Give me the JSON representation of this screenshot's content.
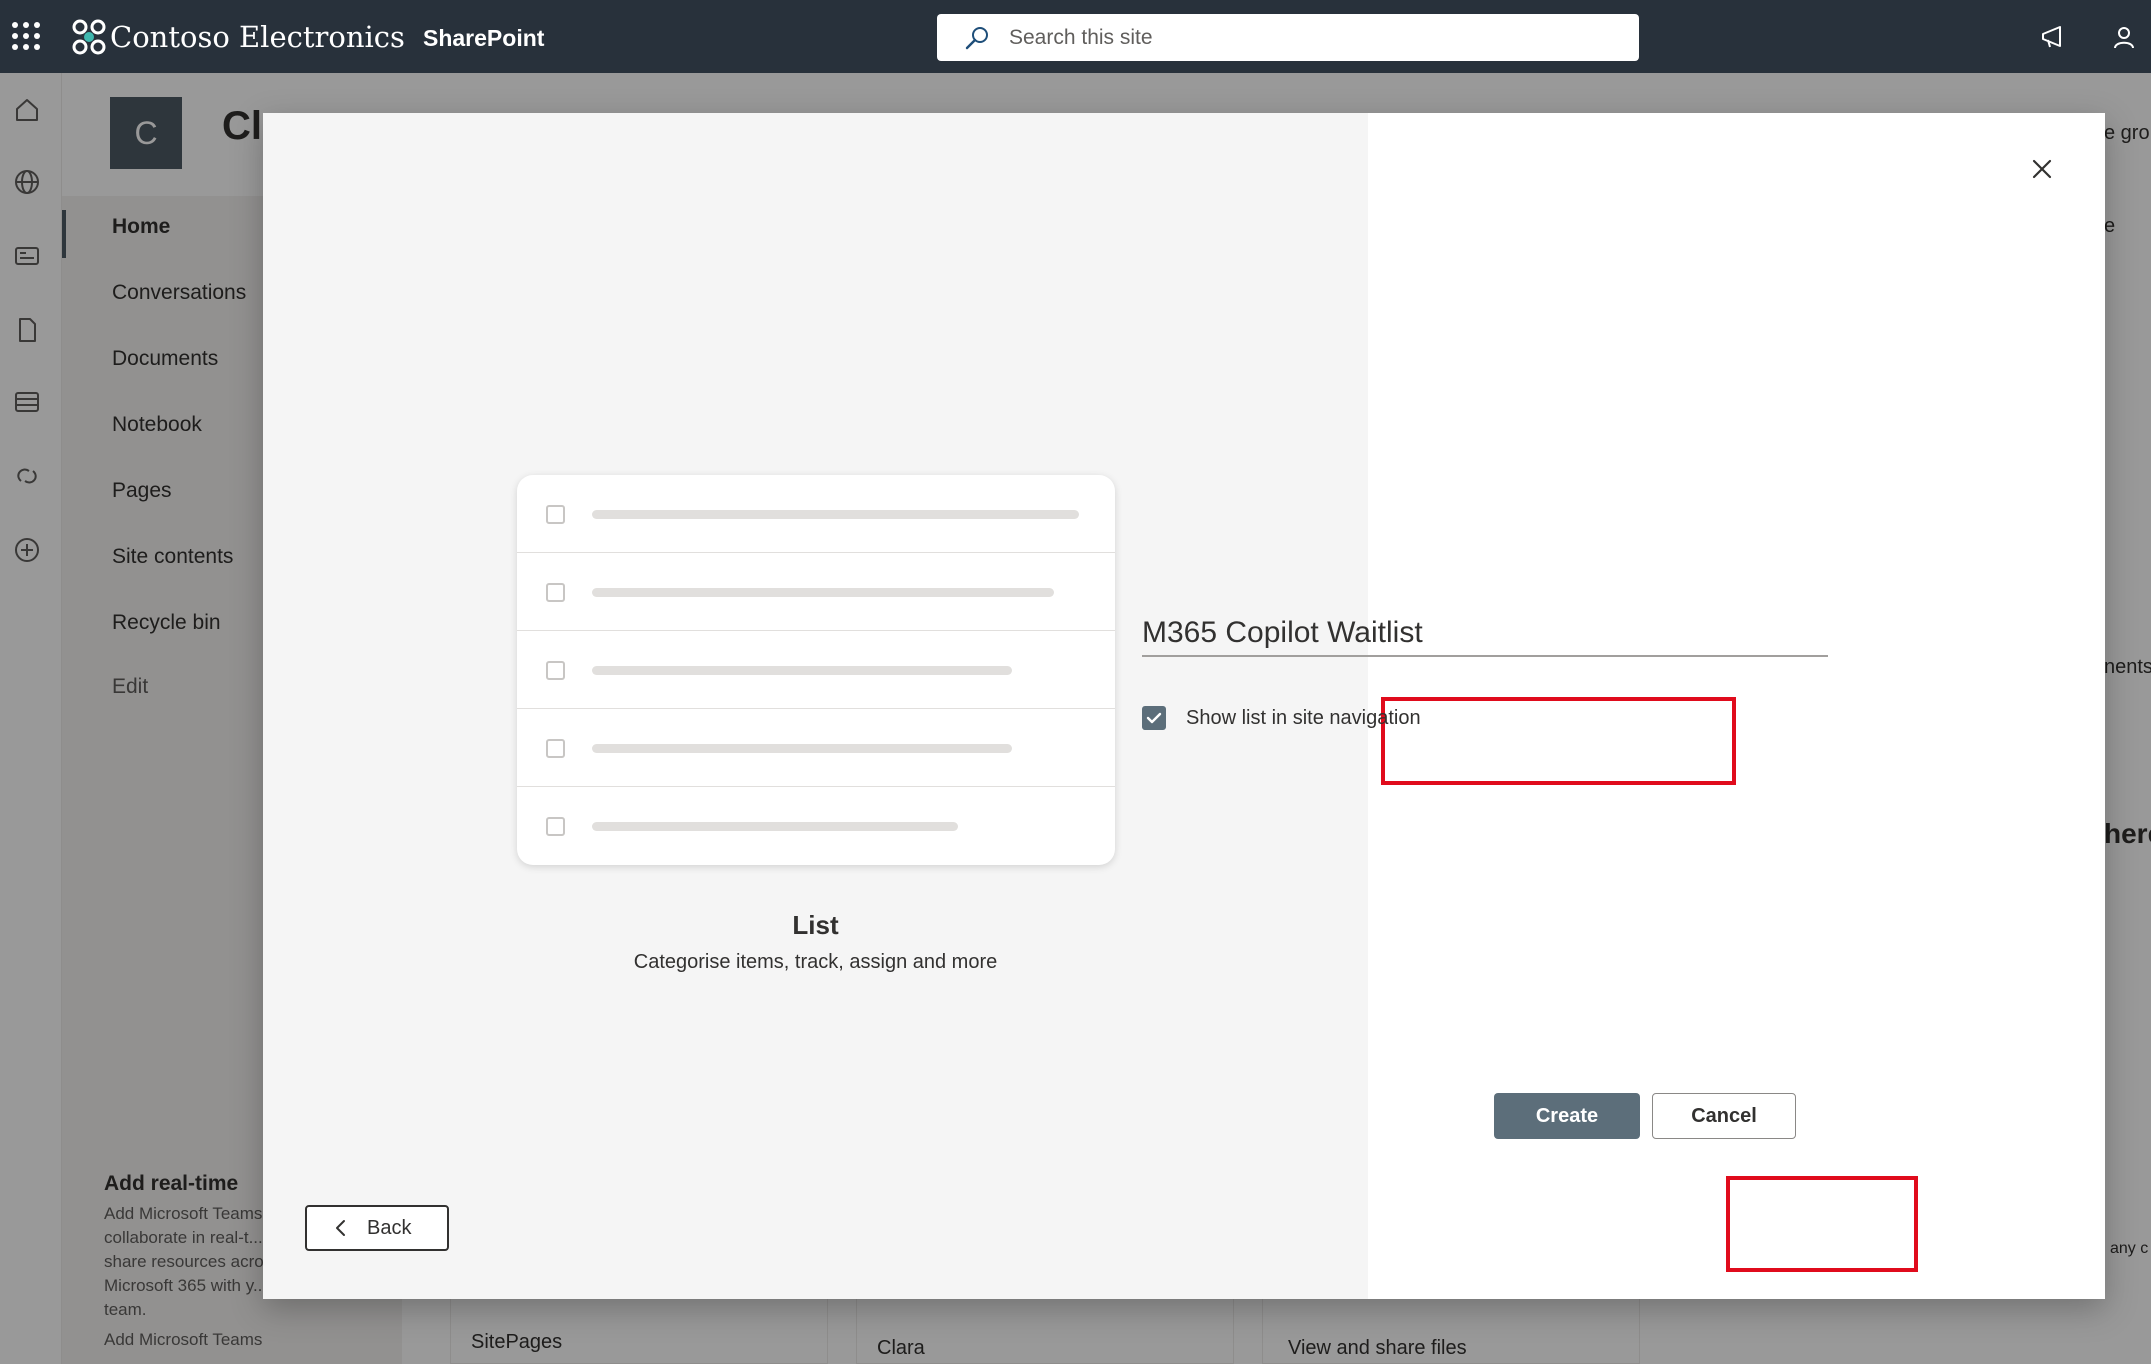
{
  "suite_bar": {
    "brand": "Contoso Electronics",
    "app": "SharePoint",
    "search_placeholder": "Search this site"
  },
  "site": {
    "logo_letter": "C",
    "title_fragment": "Cla"
  },
  "left_nav": {
    "items": [
      {
        "label": "Home",
        "active": true
      },
      {
        "label": "Conversations"
      },
      {
        "label": "Documents"
      },
      {
        "label": "Notebook"
      },
      {
        "label": "Pages"
      },
      {
        "label": "Site contents"
      },
      {
        "label": "Recycle bin"
      }
    ],
    "edit": "Edit"
  },
  "teams_promo": {
    "title": "Add real-time",
    "text": "Add Microsoft Teams to collaborate in real-t... share resources acro... Microsoft 365 with y... team.",
    "link": "Add Microsoft Teams"
  },
  "background_cards": [
    "SitePages",
    "Clara",
    "View and share files"
  ],
  "background_right": [
    "e gro",
    "e",
    "nents",
    "here",
    "any c"
  ],
  "dialog": {
    "template_name": "List",
    "template_description": "Categorise items, track, assign and more",
    "back_label": "Back",
    "name_value": "M365 Copilot Waitlist",
    "show_in_nav_label": "Show list in site navigation",
    "show_in_nav_checked": true,
    "create_label": "Create",
    "cancel_label": "Cancel"
  },
  "colors": {
    "suite_bar": "#28313b",
    "accent": "#5c6e7a",
    "highlight": "#e00b1c"
  }
}
